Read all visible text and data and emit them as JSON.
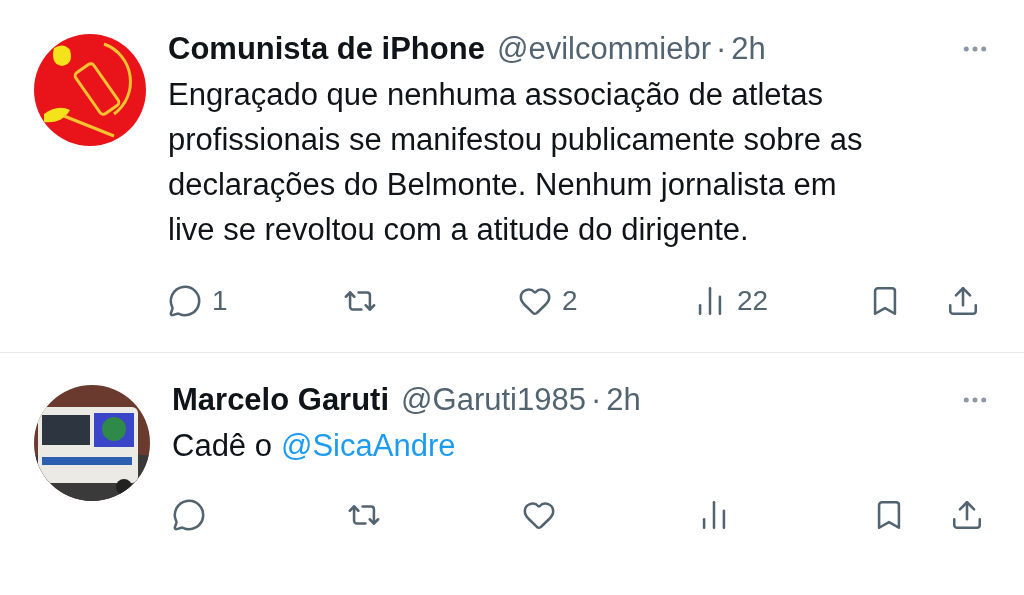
{
  "tweets": [
    {
      "name": "Comunista de iPhone",
      "handle": "@evilcommiebr",
      "separator": "·",
      "time": "2h",
      "avatar": {
        "kind": "logo"
      },
      "text": [
        {
          "kind": "text",
          "text": "Engraçado que nenhuma associação de atletas profissionais se manifestou publicamente sobre as declarações do Belmonte. Nenhum jornalista em live se revoltou com a atitude do dirigente."
        }
      ],
      "actions": [
        {
          "kind": "reply",
          "count": "1"
        },
        {
          "kind": "retweet"
        },
        {
          "kind": "like",
          "count": "2"
        },
        {
          "kind": "views",
          "count": "22"
        },
        {
          "kind": "bookmark"
        },
        {
          "kind": "share"
        }
      ]
    },
    {
      "name": "Marcelo Garuti",
      "handle": "@Garuti1985",
      "separator": "·",
      "time": "2h",
      "text": [
        {
          "kind": "text",
          "text": "Cadê o"
        },
        {
          "kind": "mention",
          "text": "@SicaAndre"
        }
      ],
      "actions": [
        {
          "kind": "reply"
        },
        {
          "kind": "retweet"
        },
        {
          "kind": "like"
        },
        {
          "kind": "views"
        },
        {
          "kind": "bookmark"
        },
        {
          "kind": "share"
        }
      ]
    }
  ]
}
